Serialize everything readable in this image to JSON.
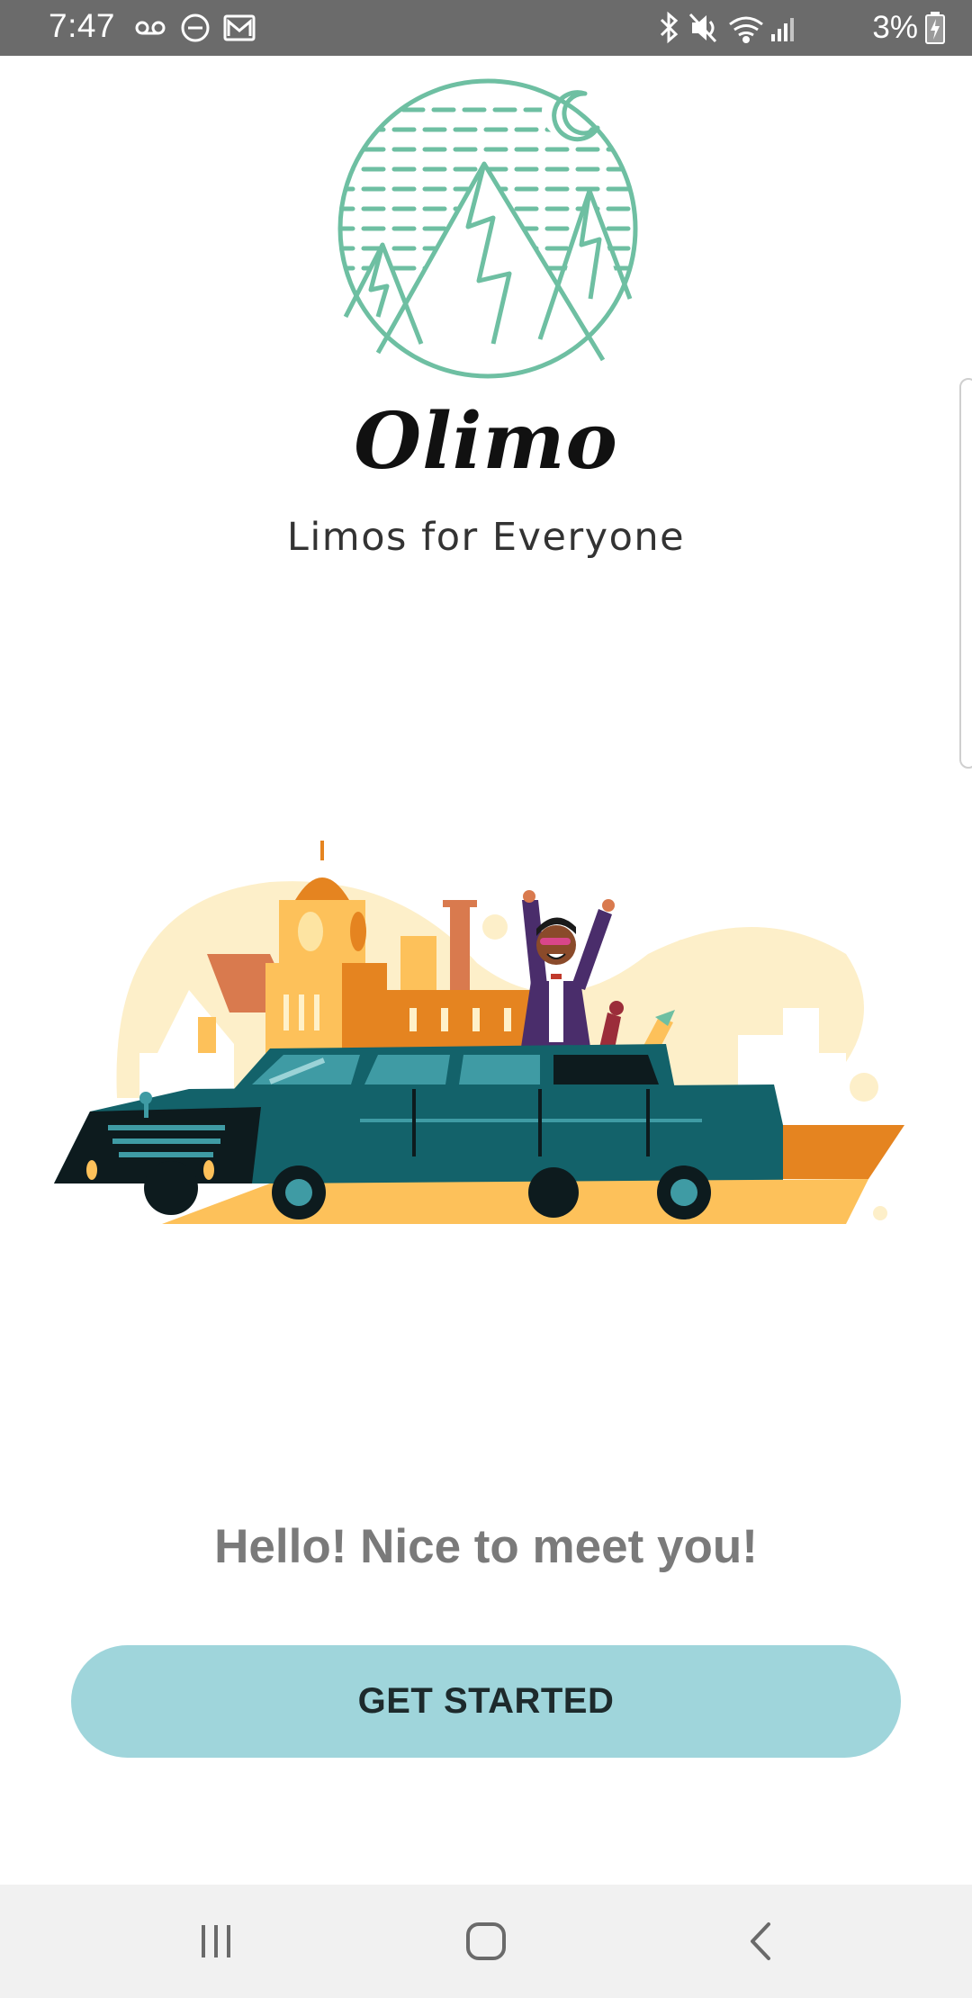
{
  "status_bar": {
    "time": "7:47",
    "battery": "3%",
    "left_icons": [
      "voicemail-icon",
      "do-not-disturb-icon",
      "gmail-icon"
    ],
    "right_icons": [
      "bluetooth-icon",
      "mute-icon",
      "wifi-icon",
      "signal-icon",
      "battery-charging-icon"
    ]
  },
  "brand": {
    "name": "Olimo",
    "tagline": "Limos for Everyone",
    "emblem_color": "#6ebfa2"
  },
  "hero": {
    "illustration": "limo-celebration-illustration"
  },
  "greeting": "Hello! Nice to meet you!",
  "cta": {
    "label": "GET STARTED",
    "color": "#9fd5db"
  },
  "nav_bar": {
    "buttons": [
      "recents-icon",
      "home-icon",
      "back-icon"
    ]
  }
}
